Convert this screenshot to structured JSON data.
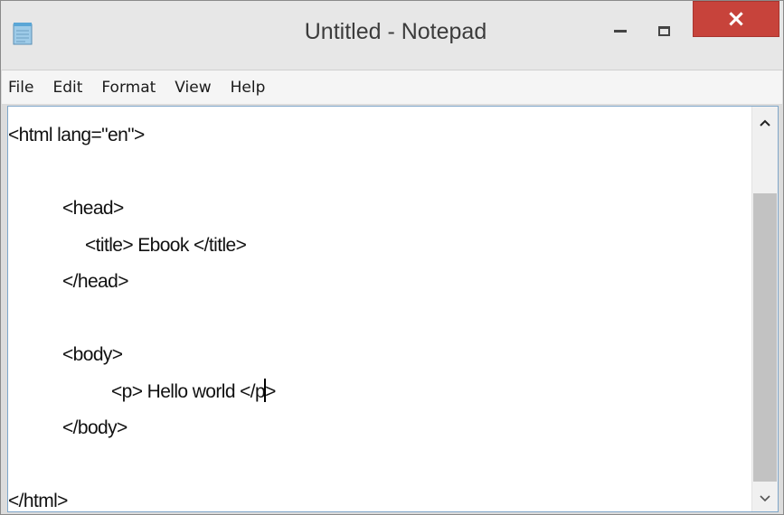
{
  "window": {
    "title": "Untitled - Notepad",
    "close_glyph": "×",
    "app_icon": "notepad-icon"
  },
  "menu": {
    "items": [
      {
        "label": "File"
      },
      {
        "label": "Edit"
      },
      {
        "label": "Format"
      },
      {
        "label": "View"
      },
      {
        "label": "Help"
      }
    ]
  },
  "editor": {
    "lines": [
      "<html lang=\"en\">",
      "",
      "<head>",
      "<title> Ebook </title>",
      "</head>",
      "",
      "<body>",
      "<p> Hello world </p",
      "</body>",
      "",
      "</html>"
    ],
    "caret_after_text": "<p> Hello world </p",
    "caret_following_text": ">"
  },
  "scrollbar": {
    "up_icon": "chevron-up-icon",
    "down_icon": "chevron-down-icon",
    "up_glyph": "^",
    "down_glyph": "v"
  },
  "colors": {
    "close_button": "#c7433b",
    "editor_border": "#7fa6c9",
    "scroll_thumb": "#c2c2c2"
  }
}
